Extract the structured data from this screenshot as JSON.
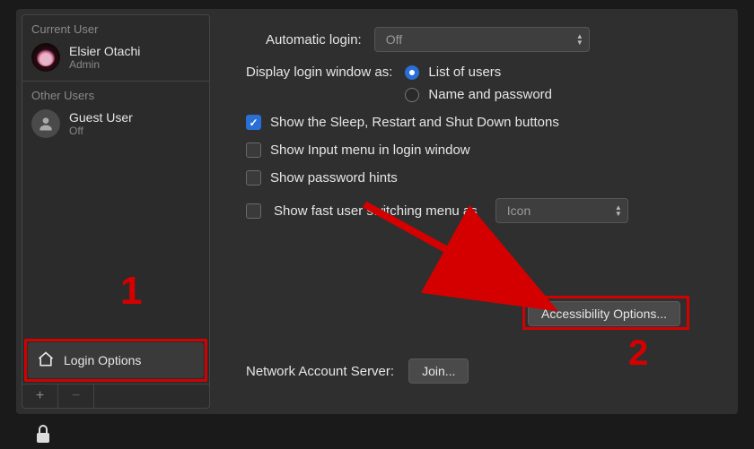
{
  "sidebar": {
    "current_header": "Current User",
    "current_user": {
      "name": "Elsier Otachi",
      "role": "Admin"
    },
    "other_header": "Other Users",
    "other_users": [
      {
        "name": "Guest User",
        "status": "Off"
      }
    ],
    "login_options_label": "Login Options"
  },
  "main": {
    "automatic_login_label": "Automatic login:",
    "automatic_login_value": "Off",
    "display_login_label": "Display login window as:",
    "display_login_options": {
      "list": "List of users",
      "name_pw": "Name and password",
      "selected": "list"
    },
    "checks": {
      "sleep_restart": {
        "label": "Show the Sleep, Restart and Shut Down buttons",
        "checked": true
      },
      "input_menu": {
        "label": "Show Input menu in login window",
        "checked": false
      },
      "pw_hints": {
        "label": "Show password hints",
        "checked": false
      },
      "fast_switch": {
        "label": "Show fast user switching menu as",
        "checked": false,
        "popup_value": "Icon"
      }
    },
    "accessibility_button": "Accessibility Options...",
    "network_label": "Network Account Server:",
    "join_button": "Join..."
  },
  "annotations": {
    "step1": "1",
    "step2": "2"
  }
}
